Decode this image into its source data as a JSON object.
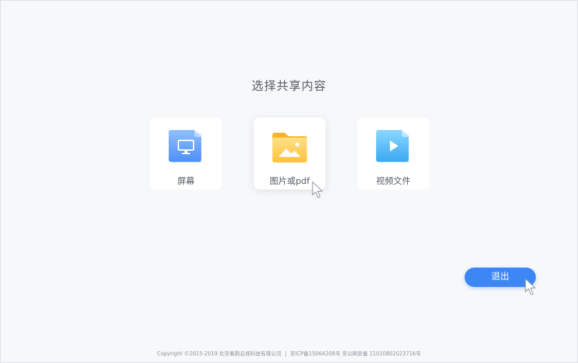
{
  "page": {
    "title": "选择共享内容"
  },
  "options": [
    {
      "label": "屏幕",
      "icon": "monitor-icon",
      "color": "#5b9cff"
    },
    {
      "label": "图片或pdf",
      "icon": "folder-image-icon",
      "color": "#ffc93f"
    },
    {
      "label": "视频文件",
      "icon": "video-play-icon",
      "color": "#49b8f5"
    }
  ],
  "actions": {
    "exit_label": "退出",
    "accent": "#3d86f5"
  },
  "footer": {
    "copyright": "Copyright ©2015-2019 北京紫荆云视科技有限公司",
    "separator": "|",
    "icp": "京ICP备15064208号 京公网安备 11010802023716号"
  }
}
